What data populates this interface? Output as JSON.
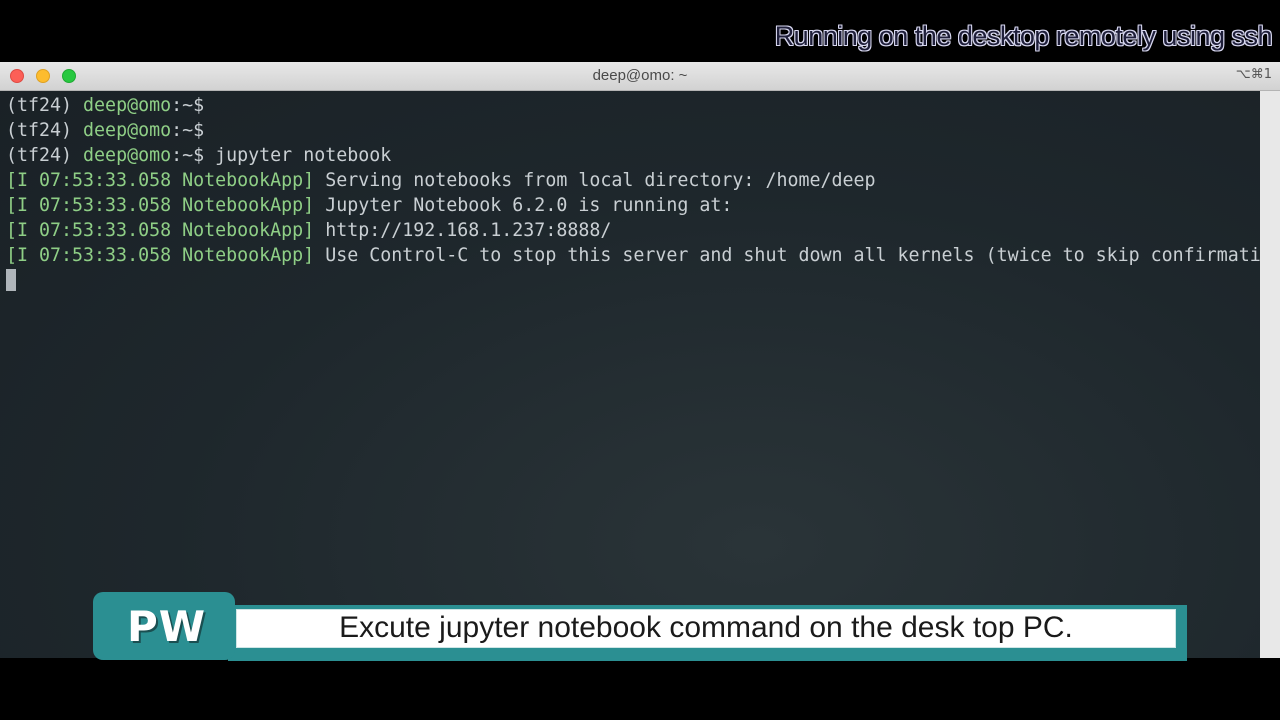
{
  "overlay": {
    "top_caption": "Running on the desktop remotely using ssh",
    "badge": "PW",
    "subtitle": "Excute jupyter notebook command on the desk top PC."
  },
  "window": {
    "title": "deep@omo: ~",
    "shortcut": "⌥⌘1"
  },
  "terminal": {
    "prompts": [
      {
        "env": "(tf24) ",
        "userhost": "deep@omo",
        "path": ":~$",
        "command": ""
      },
      {
        "env": "(tf24) ",
        "userhost": "deep@omo",
        "path": ":~$",
        "command": ""
      },
      {
        "env": "(tf24) ",
        "userhost": "deep@omo",
        "path": ":~$",
        "command": " jupyter notebook"
      }
    ],
    "log_lines": [
      {
        "tag": "[I 07:53:33.058 NotebookApp]",
        "message": " Serving notebooks from local directory: /home/deep"
      },
      {
        "tag": "[I 07:53:33.058 NotebookApp]",
        "message": " Jupyter Notebook 6.2.0 is running at:"
      },
      {
        "tag": "[I 07:53:33.058 NotebookApp]",
        "message": " http://192.168.1.237:8888/"
      },
      {
        "tag": "[I 07:53:33.058 NotebookApp]",
        "message": " Use Control-C to stop this server and shut down all kernels (twice to skip confirmation)."
      }
    ]
  },
  "colors": {
    "prompt_green": "#8fcf86",
    "terminal_bg": "#1c2328",
    "badge_teal": "#2b8f92"
  }
}
